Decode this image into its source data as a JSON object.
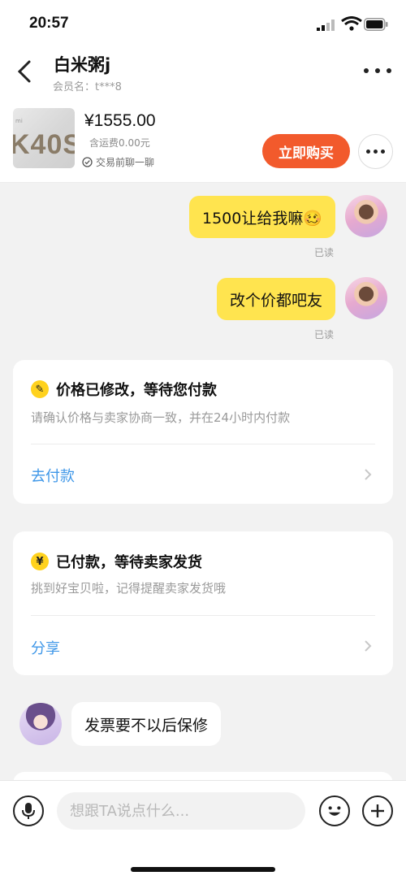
{
  "status_bar": {
    "time": "20:57"
  },
  "header": {
    "title": "白米粥j",
    "member": "会员名：t***8"
  },
  "product": {
    "thumb_text": "K40S",
    "thumb_small": "mi",
    "price": "¥1555.00",
    "shipping": "含运费0.00元",
    "chat_first": "交易前聊一聊",
    "buy_label": "立即购买"
  },
  "messages": [
    {
      "from": "me",
      "text": "1500让给我嘛🥴",
      "status": "已读"
    },
    {
      "from": "me",
      "text": "改个价都吧友",
      "status": "已读"
    }
  ],
  "cards": [
    {
      "icon_glyph": "✎",
      "title": "价格已修改，等待您付款",
      "desc": "请确认价格与卖家协商一致，并在24小时内付款",
      "action": "去付款"
    },
    {
      "icon_glyph": "¥",
      "title": "已付款，等待卖家发货",
      "desc": "挑到好宝贝啦，记得提醒卖家发货哦",
      "action": "分享"
    }
  ],
  "seller_message": {
    "from": "seller",
    "text": "发票要不以后保修"
  },
  "input": {
    "placeholder": "想跟TA说点什么..."
  },
  "colors": {
    "accent": "#f25a2c",
    "bubble": "#ffe44f",
    "link": "#3f97e8"
  }
}
